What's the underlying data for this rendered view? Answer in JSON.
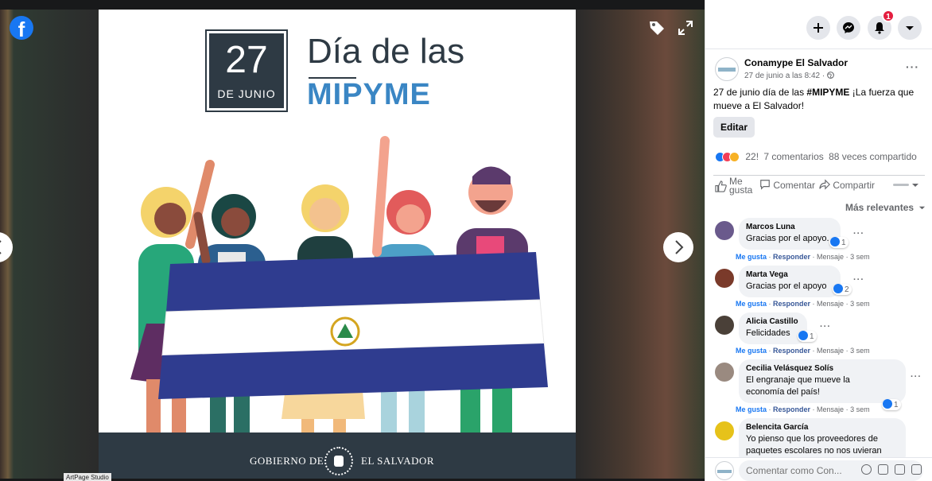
{
  "viewer": {
    "logo_glyph": "f",
    "photo": {
      "day": "27",
      "month": "DE JUNIO",
      "title_line1": "Día de las",
      "title_line2": "MIPYME",
      "footer_left": "GOBIERNO DE",
      "footer_right": "EL SALVADOR"
    },
    "watermark": "ArtPage Studio",
    "icons": [
      "facebook-logo",
      "tag-icon",
      "expand-icon",
      "chevron-right-icon",
      "chevron-left-icon"
    ]
  },
  "topbar": {
    "icons": [
      "plus-icon",
      "messenger-icon",
      "bell-icon",
      "caret-down-icon"
    ],
    "notification_count": "1"
  },
  "post": {
    "page_name": "Conamype El Salvador",
    "timestamp": "27 de junio a las 8:42 · ",
    "more": "···",
    "text_before": "27 de junio día de las ",
    "hashtag": "#MIPYME",
    "text_after": " ¡La fuerza que mueve a El Salvador!",
    "edit_label": "Editar",
    "reactions_count": "22!",
    "comments_count": "7 comentarios",
    "shares_count": "88 veces compartido",
    "like_label_line1": "Me",
    "like_label_line2": "gusta",
    "comment_label": "Comentar",
    "share_label": "Compartir",
    "sort_label": "Más relevantes"
  },
  "comments": [
    {
      "name": "Marcos Luna",
      "text": "Gracias por el apoyo.",
      "likes": "1",
      "like": "Me gusta",
      "reply": "Responder",
      "message": "Mensaje",
      "time": "3 sem",
      "more": "···"
    },
    {
      "name": "Marta Vega",
      "text": "Gracias por el apoyo",
      "likes": "2",
      "like": "Me gusta",
      "reply": "Responder",
      "message": "Mensaje",
      "time": "3 sem",
      "more": "···"
    },
    {
      "name": "Alicia Castillo",
      "text": "Felicidades",
      "likes": "1",
      "like": "Me gusta",
      "reply": "Responder",
      "message": "Mensaje",
      "time": "3 sem",
      "more": "···"
    },
    {
      "name": "Cecilia Velásquez Solís",
      "text": "El engranaje que mueve la economía del país!",
      "likes": "1",
      "like": "Me gusta",
      "reply": "Responder",
      "message": "Mensaje",
      "time": "3 sem",
      "more": "···"
    },
    {
      "name": "Belencita García",
      "text": "Yo pienso que los proveedores de paquetes escolares no nos uvieran"
    }
  ],
  "composer": {
    "placeholder": "Comentar como Con..."
  },
  "colors": {
    "accent": "#1877f2",
    "badge": "#e41e3f",
    "photo_dark": "#2e3a44",
    "mipyme_blue": "#3a86c4"
  }
}
